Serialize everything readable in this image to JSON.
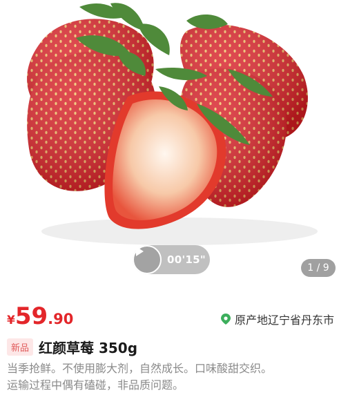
{
  "media": {
    "image_icon": "strawberry-product-image",
    "video_duration": "00'15\"",
    "page_indicator": "1 / 9"
  },
  "price": {
    "currency": "¥",
    "integer": "59",
    "decimal": ".90",
    "color": "#e3262a"
  },
  "origin": {
    "icon": "location-pin-icon",
    "text": "原产地辽宁省丹东市",
    "icon_color": "#3cae5c"
  },
  "product": {
    "tag": "新品",
    "title": "红颜草莓 350g",
    "description_lines": [
      "当季抢鲜。不使用膨大剂，自然成长。口味酸甜交织。",
      "运输过程中偶有磕碰，非品质问题。"
    ]
  }
}
